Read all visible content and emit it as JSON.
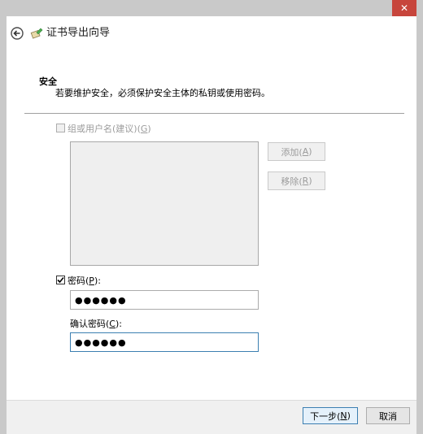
{
  "window": {
    "close_glyph": "✕"
  },
  "header": {
    "title": "证书导出向导",
    "back_icon": "back-arrow-icon",
    "wizard_icon": "certificate-icon"
  },
  "section": {
    "title": "安全",
    "description": "若要维护安全，必须保护安全主体的私钥或使用密码。"
  },
  "group_option": {
    "label": "组或用户名(建议)(",
    "mnemonic": "G",
    "suffix": ")",
    "checked": false,
    "enabled": false
  },
  "add_button": {
    "label": "添加(",
    "mnemonic": "A",
    "suffix": ")"
  },
  "remove_button": {
    "label": "移除(",
    "mnemonic": "R",
    "suffix": ")"
  },
  "password_option": {
    "label": "密码(",
    "mnemonic": "P",
    "suffix": "):",
    "checked": true
  },
  "password_field": {
    "value": "●●●●●●"
  },
  "confirm_label": {
    "label": "确认密码(",
    "mnemonic": "C",
    "suffix": "):"
  },
  "confirm_field": {
    "value": "●●●●●●"
  },
  "footer": {
    "next": {
      "label": "下一步(",
      "mnemonic": "N",
      "suffix": ")"
    },
    "cancel": {
      "label": "取消"
    }
  },
  "colors": {
    "close_red": "#c7453c",
    "focus_blue": "#3c7fb1",
    "chrome": "#c9c9c9"
  }
}
